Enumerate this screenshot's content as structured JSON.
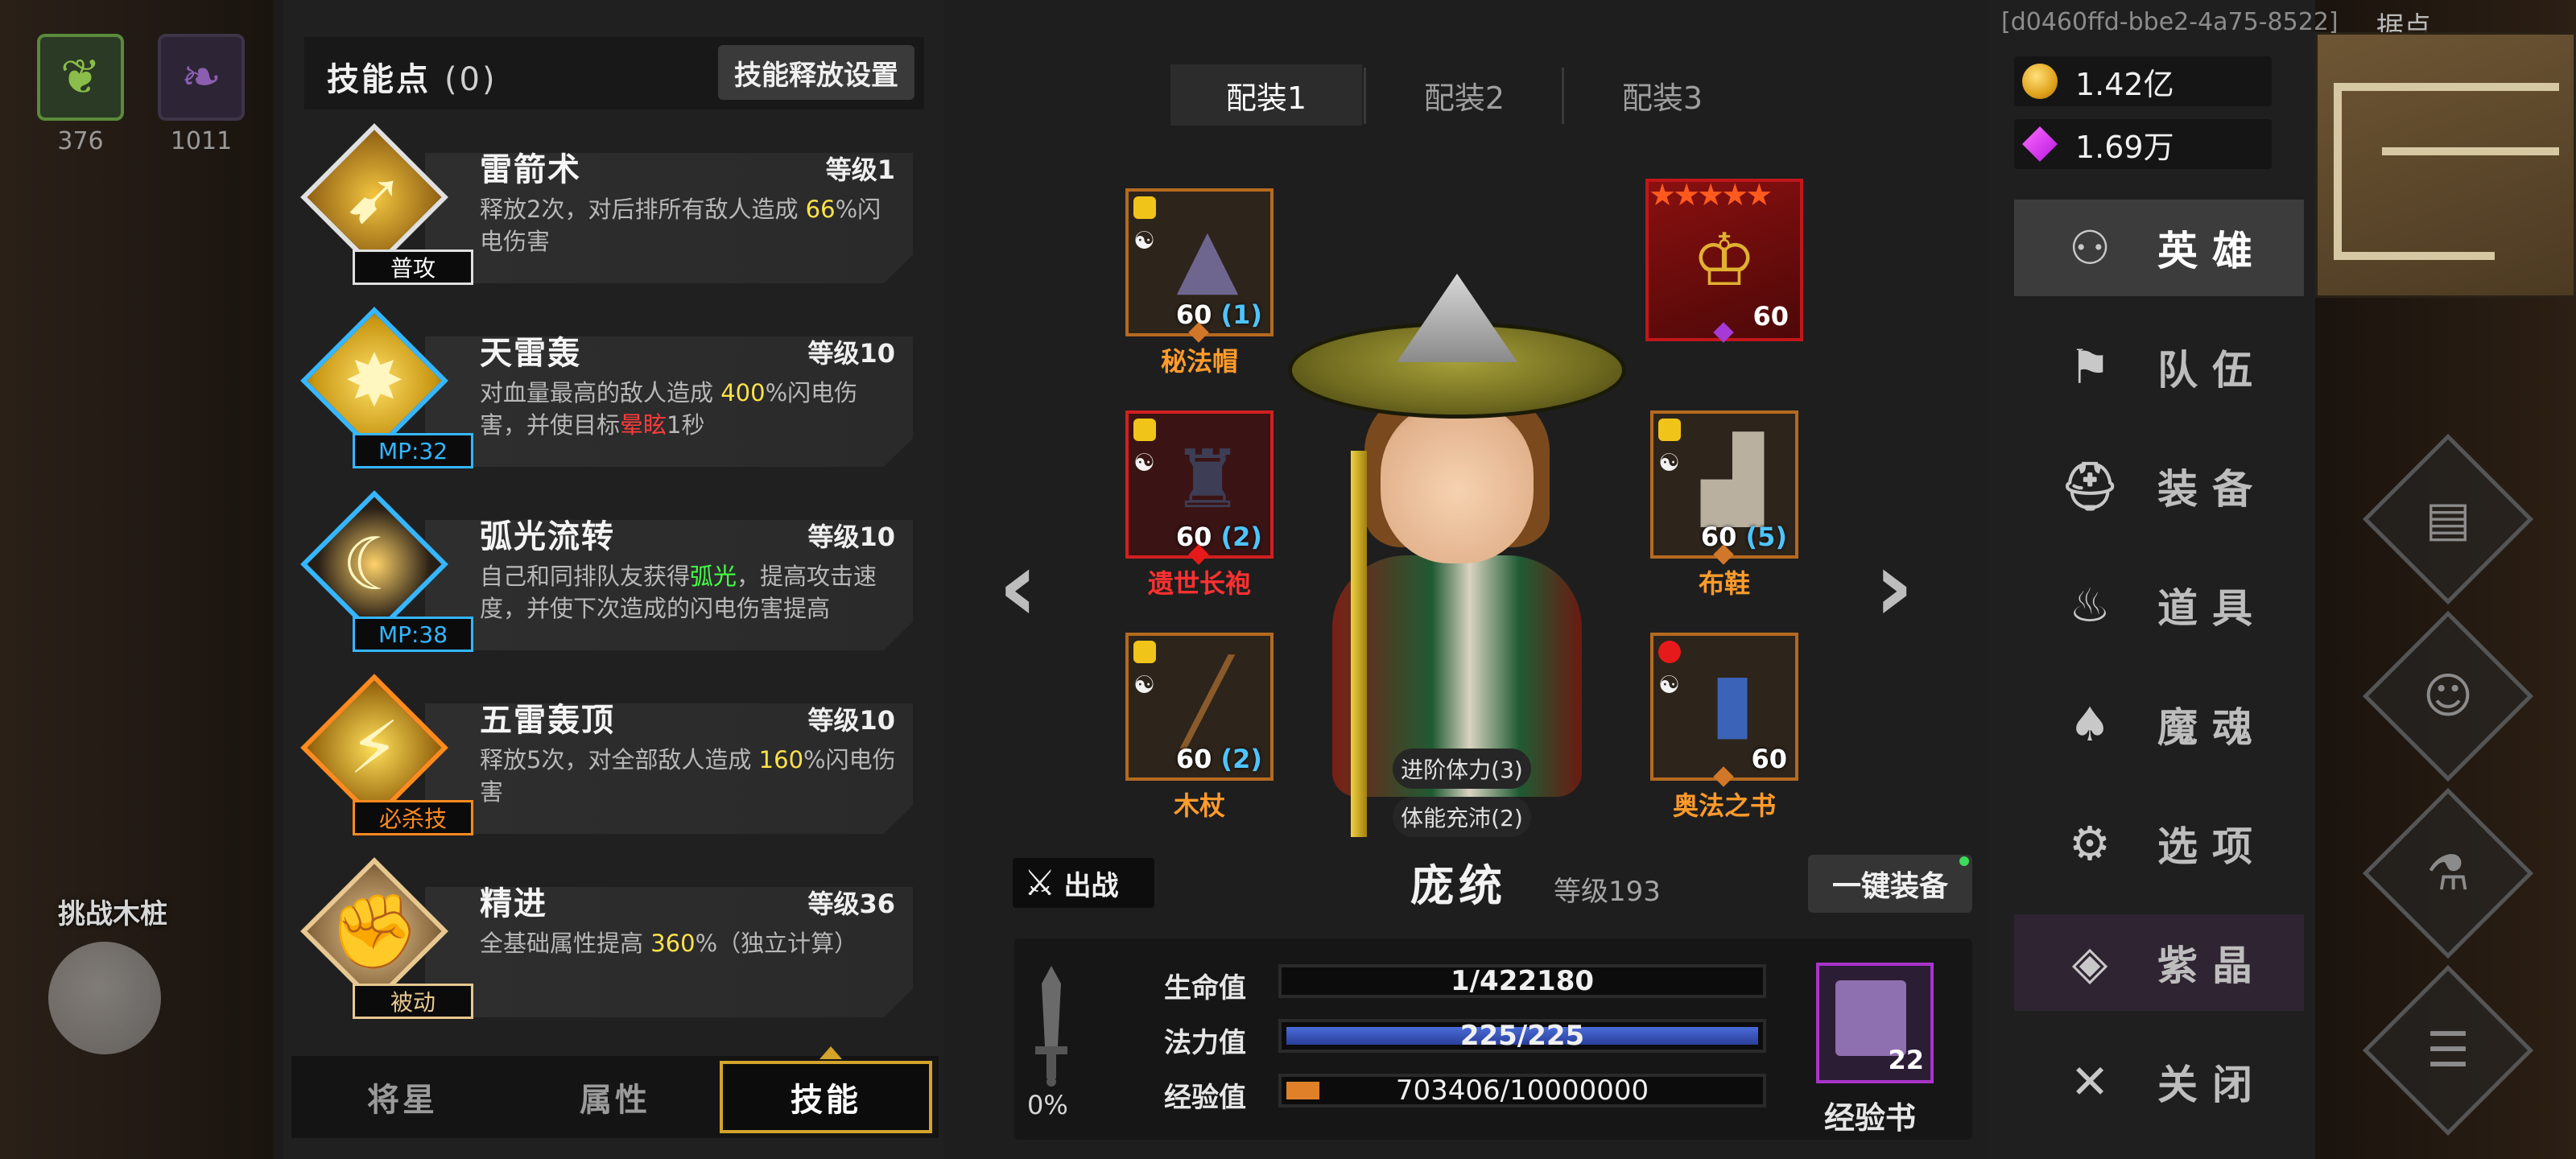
{
  "uid": "[d0460ffd-bbe2-4a75-8522]",
  "background": {
    "resources": [
      {
        "icon": "green-leaf-icon",
        "count": "376"
      },
      {
        "icon": "purple-feather-icon",
        "count": "1011"
      }
    ],
    "challenge_label": "挑战木桩",
    "minimap_title": "据点"
  },
  "skills_panel": {
    "title": "技能点",
    "points": "(0)",
    "release_settings_label": "技能释放设置",
    "skills": [
      {
        "name": "雷箭术",
        "level": "等级1",
        "tag": "普攻",
        "tag_color": "#ffffff",
        "icon": "lightning-arrow-icon",
        "desc": [
          {
            "t": "释放2次，对后排所有敌人造成 "
          },
          {
            "t": "66",
            "c": "y"
          },
          {
            "t": "%闪电伤害"
          }
        ]
      },
      {
        "name": "天雷轰",
        "level": "等级10",
        "tag": "MP:32",
        "tag_color": "#35b6ff",
        "icon": "thunder-strike-icon",
        "desc": [
          {
            "t": "对血量最高的敌人造成 "
          },
          {
            "t": "400",
            "c": "y"
          },
          {
            "t": "%闪电伤害，并使目标"
          },
          {
            "t": "晕眩",
            "c": "r"
          },
          {
            "t": "1秒"
          }
        ]
      },
      {
        "name": "弧光流转",
        "level": "等级10",
        "tag": "MP:38",
        "tag_color": "#35b6ff",
        "icon": "arc-moon-icon",
        "desc": [
          {
            "t": "自己和同排队友获得"
          },
          {
            "t": "弧光",
            "c": "g"
          },
          {
            "t": "，提高攻击速度，并使下次造成的闪电伤害提高"
          }
        ]
      },
      {
        "name": "五雷轰顶",
        "level": "等级10",
        "tag": "必杀技",
        "tag_color": "#ff8a1e",
        "icon": "five-thunder-icon",
        "desc": [
          {
            "t": "释放5次，对全部敌人造成 "
          },
          {
            "t": "160",
            "c": "y"
          },
          {
            "t": "%闪电伤害"
          }
        ]
      },
      {
        "name": "精进",
        "level": "等级36",
        "tag": "被动",
        "tag_color": "#e8c890",
        "icon": "fist-icon",
        "desc": [
          {
            "t": "全基础属性提高 "
          },
          {
            "t": "360",
            "c": "y"
          },
          {
            "t": "%（独立计算）"
          }
        ]
      }
    ],
    "bottom_tabs": [
      "将星",
      "属性",
      "技能"
    ],
    "active_tab": 2
  },
  "loadout_tabs": [
    "配装1",
    "配装2",
    "配装3"
  ],
  "active_loadout": 0,
  "equipment": {
    "hat": {
      "name": "秘法帽",
      "level": "60",
      "bonus": "(1)"
    },
    "robe": {
      "name": "遗世长袍",
      "level": "60",
      "bonus": "(2)"
    },
    "staff": {
      "name": "木杖",
      "level": "60",
      "bonus": "(2)"
    },
    "portrait": {
      "level": "60",
      "stars": "★★★★★"
    },
    "shoes": {
      "name": "布鞋",
      "level": "60",
      "bonus": "(5)"
    },
    "book": {
      "name": "奥法之书",
      "level": "60"
    }
  },
  "hero": {
    "stat_pill_1": "进阶体力(3)",
    "stat_pill_2": "体能充沛(2)",
    "sortie_label": "出战",
    "name": "庞统",
    "level": "等级193",
    "equip_all_label": "一键装备",
    "power_percent": "0%",
    "hp_label": "生命值",
    "hp_value": "1/422180",
    "hp_fraction": 0.0,
    "mp_label": "法力值",
    "mp_value": "225/225",
    "mp_fraction": 1.0,
    "exp_label": "经验值",
    "exp_value": "703406/10000000",
    "exp_fraction": 0.07,
    "exp_book_count": "22",
    "exp_book_label": "经验书"
  },
  "currency": {
    "gold": "1.42亿",
    "gems": "1.69万"
  },
  "nav": [
    {
      "label": "英雄",
      "icon": "heroes-icon"
    },
    {
      "label": "队伍",
      "icon": "flag-icon"
    },
    {
      "label": "装备",
      "icon": "helmet-icon"
    },
    {
      "label": "道具",
      "icon": "bag-icon"
    },
    {
      "label": "魔魂",
      "icon": "flame-icon"
    },
    {
      "label": "选项",
      "icon": "gear-icon"
    },
    {
      "label": "紫晶",
      "icon": "crystal-icon"
    },
    {
      "label": "关闭",
      "icon": "close-icon"
    }
  ],
  "colors": {
    "accent_gold": "#d3a42a",
    "item_orange": "#ff9b2b",
    "item_red": "#ff3030",
    "mp_blue": "#35b6ff"
  }
}
